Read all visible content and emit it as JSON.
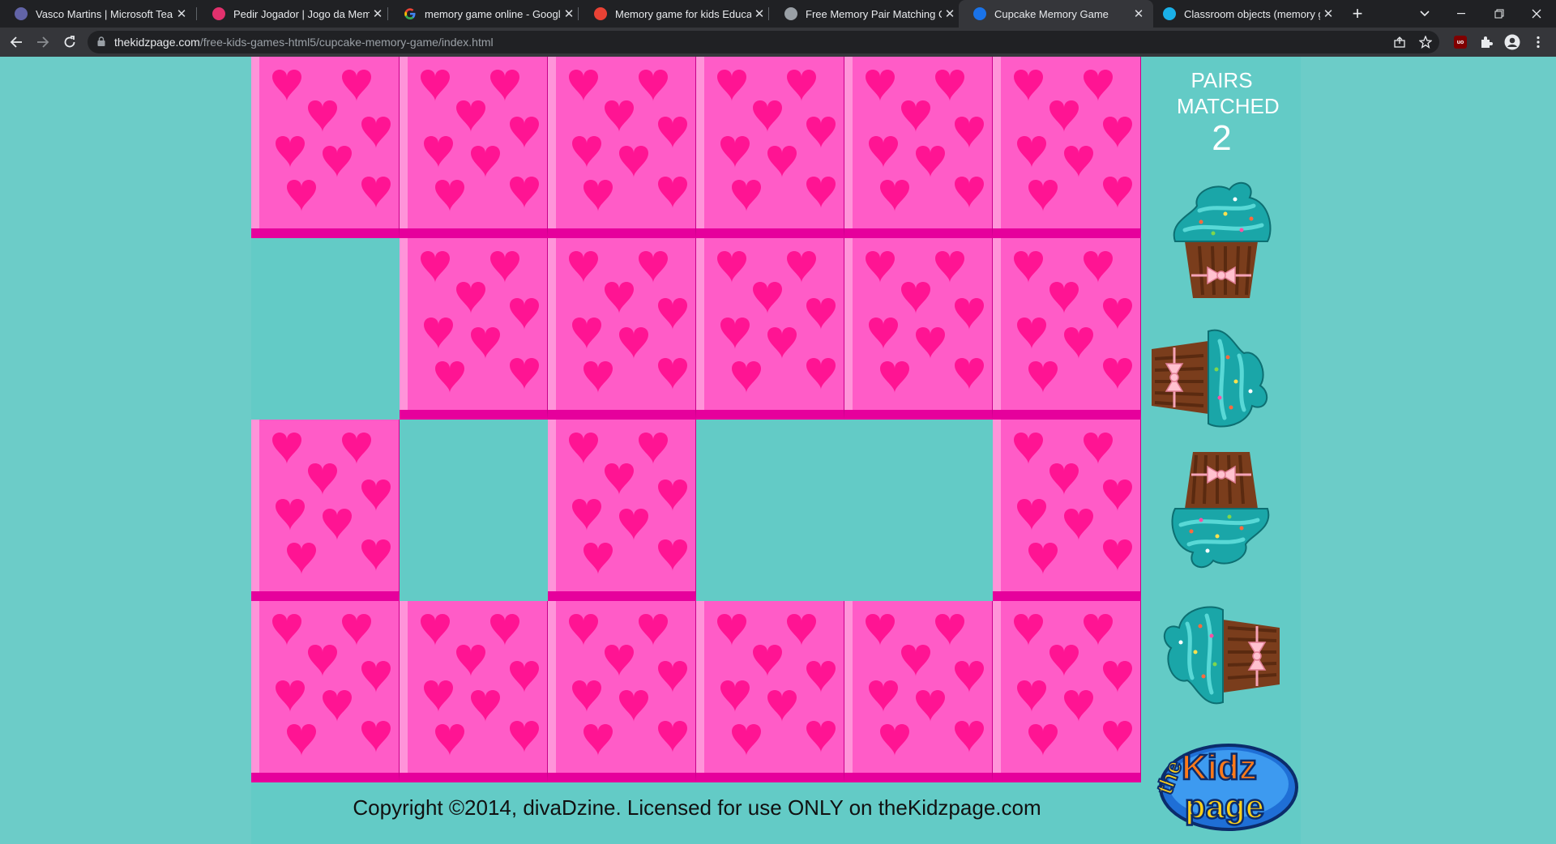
{
  "browser": {
    "tabs": [
      {
        "title": "Vasco Martins | Microsoft Teams",
        "favicon": "teams-icon",
        "color": "#6264a7",
        "active": false
      },
      {
        "title": "Pedir Jogador | Jogo da Memória",
        "favicon": "site-icon",
        "color": "#e2316d",
        "active": false
      },
      {
        "title": "memory game online - Google Search",
        "favicon": "google-icon",
        "color": "#ffffff",
        "active": false
      },
      {
        "title": "Memory game for kids Educational",
        "favicon": "site-icon",
        "color": "#e94235",
        "active": false
      },
      {
        "title": "Free Memory Pair Matching Game",
        "favicon": "globe-icon",
        "color": "#9aa0a6",
        "active": false
      },
      {
        "title": "Cupcake Memory Game",
        "favicon": "kidzpage-icon",
        "color": "#1a73e8",
        "active": true
      },
      {
        "title": "Classroom objects (memory game)",
        "favicon": "site-icon",
        "color": "#1ab0e8",
        "active": false
      }
    ],
    "url_host": "thekidzpage.com",
    "url_path": "/free-kids-games-html5/cupcake-memory-game/index.html",
    "extension_badge": "uo"
  },
  "game": {
    "pairs_label": "PAIRS MATCHED",
    "pairs_count": "2",
    "copyright": "Copyright ©2014, divaDzine. Licensed for use ONLY on theKidzpage.com",
    "logo_text_top": "the",
    "logo_text_mid": "Kidz",
    "logo_text_bottom": "page",
    "grid_rows": 4,
    "grid_cols": 6,
    "cards": [
      [
        true,
        true,
        true,
        true,
        true,
        true
      ],
      [
        false,
        true,
        true,
        true,
        true,
        true
      ],
      [
        true,
        false,
        true,
        false,
        false,
        true
      ],
      [
        true,
        true,
        true,
        true,
        true,
        true
      ]
    ],
    "colors": {
      "background": "#63cbc6",
      "card": "#ff5cc7",
      "heart": "#ff1493",
      "frosting": "#1aa6a8",
      "cake": "#7a3d1c"
    }
  }
}
